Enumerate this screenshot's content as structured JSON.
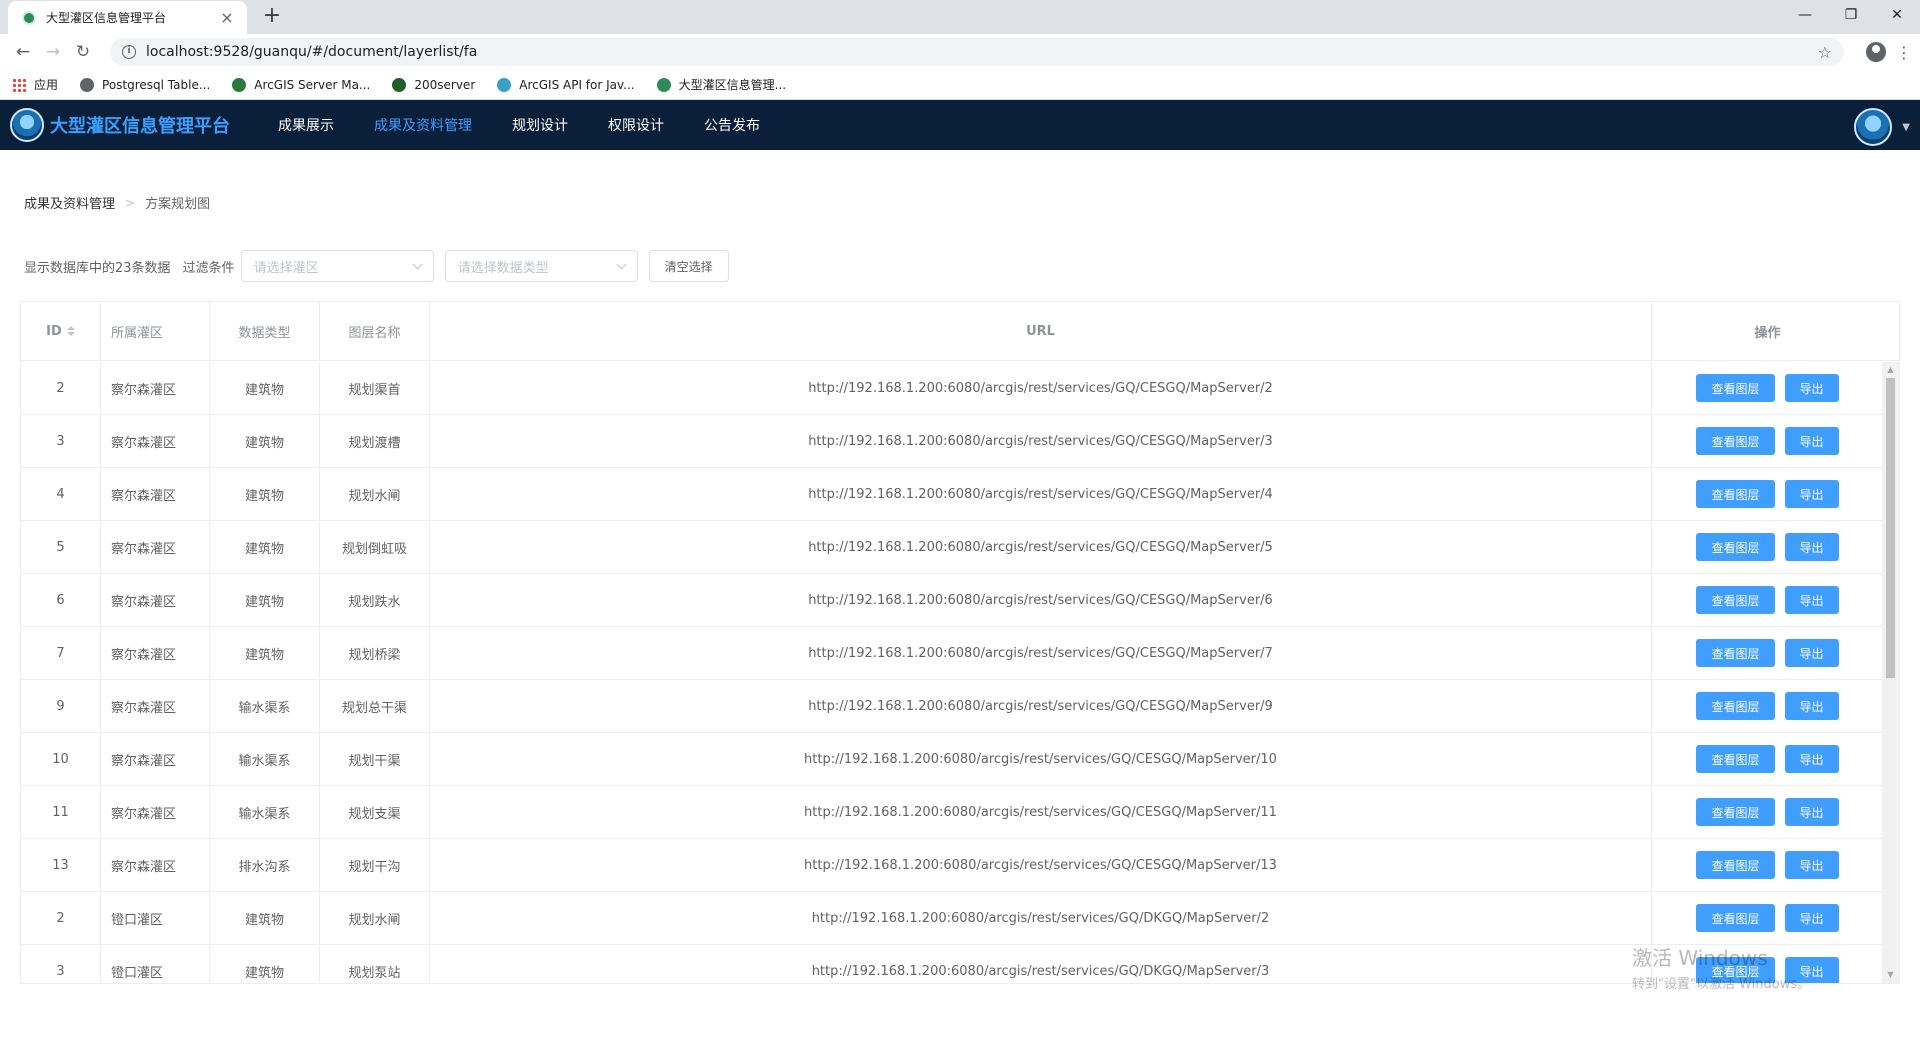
{
  "browser": {
    "tab_title": "大型灌区信息管理平台",
    "tab_close": "×",
    "new_tab": "+",
    "url": "localhost:9528/guanqu/#/document/layerlist/fa",
    "bookmarks": [
      {
        "label": "应用",
        "color": "#ea4335"
      },
      {
        "label": "Postgresql Table...",
        "color": "#5f6368"
      },
      {
        "label": "ArcGIS Server Ma...",
        "color": "#2b7a3d"
      },
      {
        "label": "200server",
        "color": "#1f5f2a"
      },
      {
        "label": "ArcGIS API for Jav...",
        "color": "#3aa0c8"
      },
      {
        "label": "大型灌区信息管理...",
        "color": "#2e8b57"
      }
    ]
  },
  "app": {
    "title": "大型灌区信息管理平台",
    "nav": [
      {
        "label": "成果展示",
        "active": false
      },
      {
        "label": "成果及资料管理",
        "active": true
      },
      {
        "label": "规划设计",
        "active": false
      },
      {
        "label": "权限设计",
        "active": false
      },
      {
        "label": "公告发布",
        "active": false
      }
    ]
  },
  "breadcrumb": {
    "first": "成果及资料管理",
    "sep": ">",
    "last": "方案规划图"
  },
  "filter": {
    "count_text": "显示数据库中的23条数据",
    "label": "过滤条件",
    "area_placeholder": "请选择灌区",
    "type_placeholder": "请选择数据类型",
    "clear_label": "清空选择"
  },
  "table": {
    "headers": {
      "id": "ID",
      "area": "所属灌区",
      "type": "数据类型",
      "name": "图层名称",
      "url": "URL",
      "op": "操作"
    },
    "view_label": "查看图层",
    "export_label": "导出",
    "rows": [
      {
        "id": "2",
        "area": "察尔森灌区",
        "type": "建筑物",
        "name": "规划渠首",
        "url": "http://192.168.1.200:6080/arcgis/rest/services/GQ/CESGQ/MapServer/2"
      },
      {
        "id": "3",
        "area": "察尔森灌区",
        "type": "建筑物",
        "name": "规划渡槽",
        "url": "http://192.168.1.200:6080/arcgis/rest/services/GQ/CESGQ/MapServer/3"
      },
      {
        "id": "4",
        "area": "察尔森灌区",
        "type": "建筑物",
        "name": "规划水闸",
        "url": "http://192.168.1.200:6080/arcgis/rest/services/GQ/CESGQ/MapServer/4"
      },
      {
        "id": "5",
        "area": "察尔森灌区",
        "type": "建筑物",
        "name": "规划倒虹吸",
        "url": "http://192.168.1.200:6080/arcgis/rest/services/GQ/CESGQ/MapServer/5"
      },
      {
        "id": "6",
        "area": "察尔森灌区",
        "type": "建筑物",
        "name": "规划跌水",
        "url": "http://192.168.1.200:6080/arcgis/rest/services/GQ/CESGQ/MapServer/6"
      },
      {
        "id": "7",
        "area": "察尔森灌区",
        "type": "建筑物",
        "name": "规划桥梁",
        "url": "http://192.168.1.200:6080/arcgis/rest/services/GQ/CESGQ/MapServer/7"
      },
      {
        "id": "9",
        "area": "察尔森灌区",
        "type": "输水渠系",
        "name": "规划总干渠",
        "url": "http://192.168.1.200:6080/arcgis/rest/services/GQ/CESGQ/MapServer/9"
      },
      {
        "id": "10",
        "area": "察尔森灌区",
        "type": "输水渠系",
        "name": "规划干渠",
        "url": "http://192.168.1.200:6080/arcgis/rest/services/GQ/CESGQ/MapServer/10"
      },
      {
        "id": "11",
        "area": "察尔森灌区",
        "type": "输水渠系",
        "name": "规划支渠",
        "url": "http://192.168.1.200:6080/arcgis/rest/services/GQ/CESGQ/MapServer/11"
      },
      {
        "id": "13",
        "area": "察尔森灌区",
        "type": "排水沟系",
        "name": "规划干沟",
        "url": "http://192.168.1.200:6080/arcgis/rest/services/GQ/CESGQ/MapServer/13"
      },
      {
        "id": "2",
        "area": "镫口灌区",
        "type": "建筑物",
        "name": "规划水闸",
        "url": "http://192.168.1.200:6080/arcgis/rest/services/GQ/DKGQ/MapServer/2"
      },
      {
        "id": "3",
        "area": "镫口灌区",
        "type": "建筑物",
        "name": "规划泵站",
        "url": "http://192.168.1.200:6080/arcgis/rest/services/GQ/DKGQ/MapServer/3"
      }
    ]
  },
  "watermark": {
    "line1": "激活 Windows",
    "line2": "转到\"设置\"以激活 Windows。"
  }
}
